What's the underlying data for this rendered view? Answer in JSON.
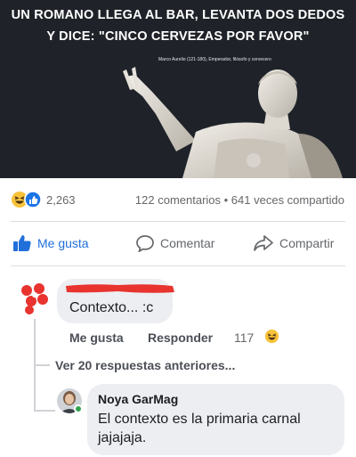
{
  "post_image": {
    "caption_line1": "UN ROMANO LLEGA AL BAR, LEVANTA DOS DEDOS",
    "caption_line2": "Y DICE: \"CINCO CERVEZAS POR FAVOR\"",
    "credit": "Marco Aurelio (121-180), Emperador, filósofo y cervecero",
    "background_color": "#1f2329"
  },
  "stats": {
    "reactions_count": "2,263",
    "reaction_icons": [
      "haha-icon",
      "like-icon"
    ],
    "comments_shares": "122 comentarios • 641 veces compartido"
  },
  "actions": {
    "like_label": "Me gusta",
    "comment_label": "Comentar",
    "share_label": "Compartir",
    "like_color": "#216fdb"
  },
  "comment": {
    "text": "Contexto... :c",
    "like_label": "Me gusta",
    "reply_label": "Responder",
    "reaction_count": "117",
    "reaction_icon": "haha-icon",
    "redaction_color": "#e8332f"
  },
  "view_previous": "Ver 20 respuestas anteriores...",
  "reply": {
    "author": "Noya GarMag",
    "text": "El contexto es la primaria carnal jajajaja.",
    "online_color": "#31a24c"
  }
}
